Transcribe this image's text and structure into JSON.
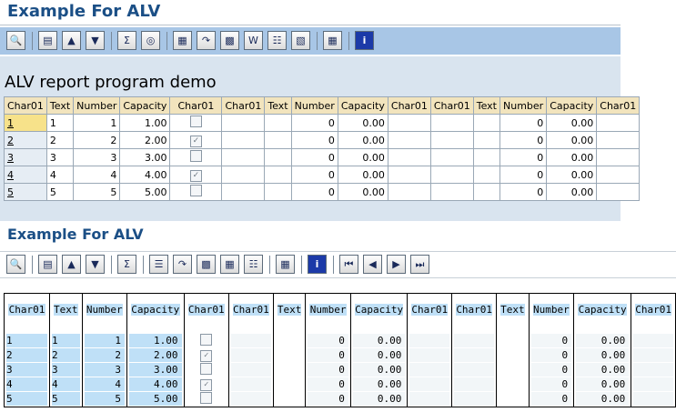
{
  "section1": {
    "title": "Example For ALV",
    "report_title": "ALV report program demo",
    "columns": [
      "Char01",
      "Text",
      "Number",
      "Capacity",
      "Char01",
      "Char01",
      "Text",
      "Number",
      "Capacity",
      "Char01",
      "Char01",
      "Text",
      "Number",
      "Capacity",
      "Char01"
    ],
    "rows": [
      {
        "c1": "1",
        "text": "1",
        "number": "1",
        "capacity": "1.00",
        "checked": false,
        "number2": "0",
        "capacity2": "0.00",
        "number3": "0",
        "capacity3": "0.00"
      },
      {
        "c1": "2",
        "text": "2",
        "number": "2",
        "capacity": "2.00",
        "checked": true,
        "number2": "0",
        "capacity2": "0.00",
        "number3": "0",
        "capacity3": "0.00"
      },
      {
        "c1": "3",
        "text": "3",
        "number": "3",
        "capacity": "3.00",
        "checked": false,
        "number2": "0",
        "capacity2": "0.00",
        "number3": "0",
        "capacity3": "0.00"
      },
      {
        "c1": "4",
        "text": "4",
        "number": "4",
        "capacity": "4.00",
        "checked": true,
        "number2": "0",
        "capacity2": "0.00",
        "number3": "0",
        "capacity3": "0.00"
      },
      {
        "c1": "5",
        "text": "5",
        "number": "5",
        "capacity": "5.00",
        "checked": false,
        "number2": "0",
        "capacity2": "0.00",
        "number3": "0",
        "capacity3": "0.00"
      }
    ]
  },
  "section2": {
    "title": "Example For ALV",
    "columns": [
      "Char01",
      "Text",
      "Number",
      "Capacity",
      "Char01",
      "Char01",
      "Text",
      "Number",
      "Capacity",
      "Char01",
      "Char01",
      "Text",
      "Number",
      "Capacity",
      "Char01"
    ],
    "rows": [
      {
        "c1": "1",
        "text": "1",
        "number": "1",
        "capacity": "1.00",
        "checked": false,
        "number2": "0",
        "capacity2": "0.00",
        "number3": "0",
        "capacity3": "0.00"
      },
      {
        "c1": "2",
        "text": "2",
        "number": "2",
        "capacity": "2.00",
        "checked": true,
        "number2": "0",
        "capacity2": "0.00",
        "number3": "0",
        "capacity3": "0.00"
      },
      {
        "c1": "3",
        "text": "3",
        "number": "3",
        "capacity": "3.00",
        "checked": false,
        "number2": "0",
        "capacity2": "0.00",
        "number3": "0",
        "capacity3": "0.00"
      },
      {
        "c1": "4",
        "text": "4",
        "number": "4",
        "capacity": "4.00",
        "checked": true,
        "number2": "0",
        "capacity2": "0.00",
        "number3": "0",
        "capacity3": "0.00"
      },
      {
        "c1": "5",
        "text": "5",
        "number": "5",
        "capacity": "5.00",
        "checked": false,
        "number2": "0",
        "capacity2": "0.00",
        "number3": "0",
        "capacity3": "0.00"
      }
    ]
  },
  "toolbar1_icons": [
    "detail-icon",
    "print-icon",
    "sort-ascending-icon",
    "filter-icon",
    "sum-icon",
    "print-preview-icon",
    "export-icon",
    "export-file-icon",
    "local-file-icon",
    "word-processing-icon",
    "abc-analysis-icon",
    "graphic-icon",
    "layout-icon",
    "info-icon"
  ],
  "toolbar2_icons": [
    "detail-icon",
    "print-icon",
    "sort-ascending-icon",
    "filter-icon",
    "sum-icon",
    "subtotal-icon",
    "export-icon",
    "export-file-icon",
    "local-file-icon",
    "abc-analysis-icon",
    "layout-icon",
    "info-icon",
    "first-page-icon",
    "previous-page-icon",
    "next-page-icon",
    "last-page-icon"
  ],
  "colors": {
    "title": "#1b4f86",
    "toolbar": "#a8c6e6",
    "header": "#f2e4bd",
    "selected_key": "#f7e28a",
    "classic_field": "#bfe0f7"
  }
}
